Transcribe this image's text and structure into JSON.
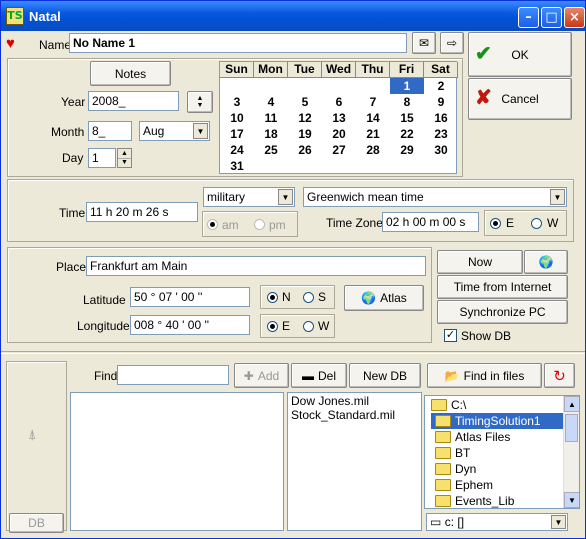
{
  "window": {
    "title": "Natal",
    "logo_text": "TS"
  },
  "name": {
    "label": "Name",
    "value": "No Name 1"
  },
  "ok_label": "OK",
  "cancel_label": "Cancel",
  "notes_label": "Notes",
  "year": {
    "label": "Year",
    "value": "2008_"
  },
  "month": {
    "label": "Month",
    "value": "8_",
    "selected": "Aug"
  },
  "day": {
    "label": "Day",
    "value": "1"
  },
  "calendar": {
    "headers": [
      "Sun",
      "Mon",
      "Tue",
      "Wed",
      "Thu",
      "Fri",
      "Sat"
    ],
    "days": [
      "",
      "",
      "",
      "",
      "",
      "1",
      "2",
      "3",
      "4",
      "5",
      "6",
      "7",
      "8",
      "9",
      "10",
      "11",
      "12",
      "13",
      "14",
      "15",
      "16",
      "17",
      "18",
      "19",
      "20",
      "21",
      "22",
      "23",
      "24",
      "25",
      "26",
      "27",
      "28",
      "29",
      "30",
      "31",
      "",
      "",
      "",
      "",
      "",
      ""
    ],
    "selected": "1"
  },
  "time": {
    "label": "Time",
    "value": "11  h 20 m  26 s",
    "format": "military",
    "zone_name": "Greenwich mean time",
    "am_label": "am",
    "pm_label": "pm",
    "zone_label": "Time Zone",
    "zone_value": "02  h 00 m  00 s",
    "e_label": "E",
    "w_label": "W"
  },
  "place": {
    "label": "Place",
    "value": "Frankfurt am Main"
  },
  "latitude": {
    "label": "Latitude",
    "value": "50  ° 07 ' 00 ''",
    "n_label": "N",
    "s_label": "S"
  },
  "longitude": {
    "label": "Longitude",
    "value": "008  ° 40 ' 00 ''",
    "e_label": "E",
    "w_label": "W"
  },
  "atlas_label": "Atlas",
  "now_label": "Now",
  "time_internet_label": "Time from Internet",
  "sync_pc_label": "Synchronize PC",
  "show_db_label": "Show DB",
  "db_label": "DB",
  "find": {
    "label": "Find",
    "value": ""
  },
  "add_label": "Add",
  "del_label": "Del",
  "new_db_label": "New DB",
  "find_in_files_label": "Find in files",
  "files": [
    "Dow Jones.mil",
    "Stock_Standard.mil"
  ],
  "tree": [
    "C:\\",
    "TimingSolution1",
    "Atlas Files",
    "BT",
    "Dyn",
    "Ephem",
    "Events_Lib"
  ],
  "tree_selected": "TimingSolution1",
  "drive": "c: []",
  "colors": {
    "title_bar": "#0a58e0",
    "selection": "#316ac5",
    "heart": "#e00000",
    "ok_check": "#1a8f1a",
    "cancel_x": "#c0180c"
  }
}
